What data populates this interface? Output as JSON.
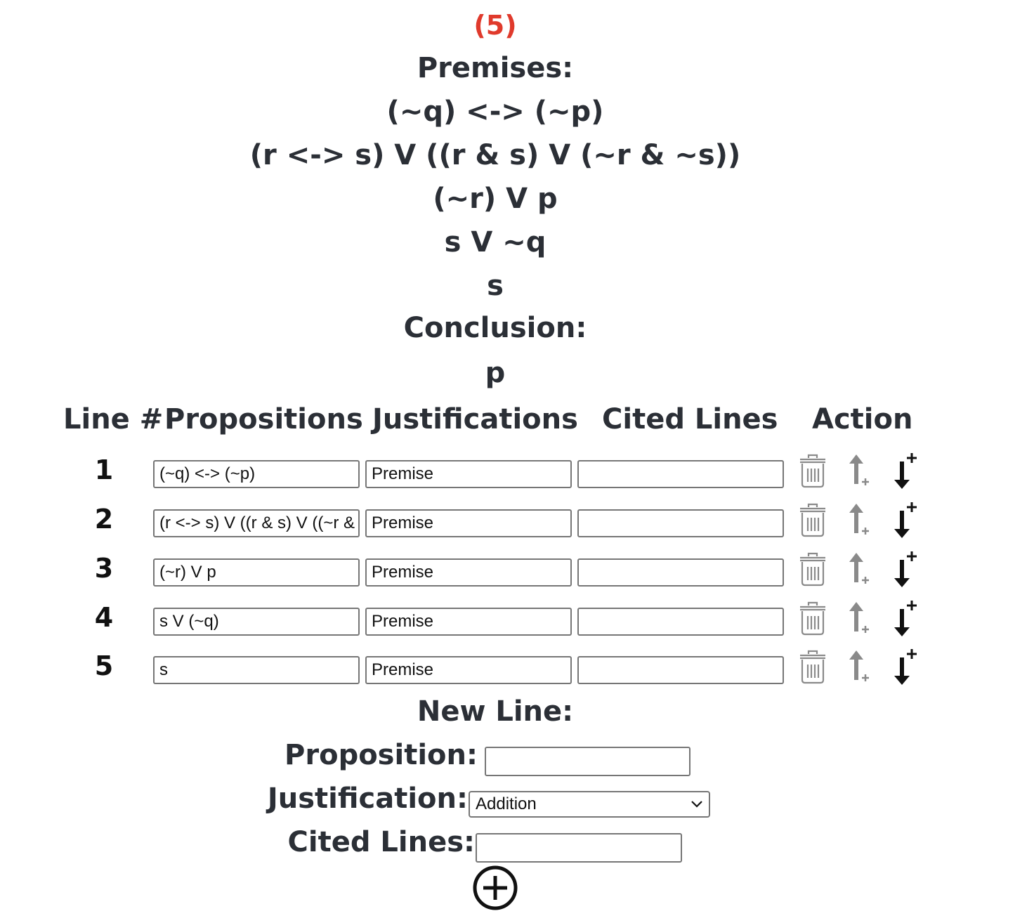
{
  "problem": {
    "number": "(5)",
    "premises_heading": "Premises:",
    "premises": [
      "(~q) <-> (~p)",
      "(r <-> s) V ((r & s) V (~r & ~s))",
      "(~r) V p",
      "s V ~q",
      "s"
    ],
    "conclusion_heading": "Conclusion:",
    "conclusion": "p"
  },
  "table": {
    "headers": {
      "line": "Line #",
      "propositions": "Propositions",
      "justifications": "Justifications",
      "cited": "Cited Lines",
      "action": "Action"
    },
    "rows": [
      {
        "num": "1",
        "proposition": "(~q) <-> (~p)",
        "justification": "Premise",
        "cited": ""
      },
      {
        "num": "2",
        "proposition": "(r <-> s) V ((r & s) V ((~r & ~s))",
        "justification": "Premise",
        "cited": ""
      },
      {
        "num": "3",
        "proposition": "(~r) V p",
        "justification": "Premise",
        "cited": ""
      },
      {
        "num": "4",
        "proposition": "s V (~q)",
        "justification": "Premise",
        "cited": ""
      },
      {
        "num": "5",
        "proposition": "s",
        "justification": "Premise",
        "cited": ""
      }
    ],
    "action_icons": [
      "trash-icon",
      "insert-above-icon",
      "insert-below-icon"
    ]
  },
  "new_line": {
    "heading": "New Line:",
    "proposition_label": "Proposition:",
    "proposition_value": "",
    "justification_label": "Justification:",
    "justification_selected": "Addition",
    "cited_label": "Cited Lines:",
    "cited_value": "",
    "add_icon": "plus-circle-icon"
  },
  "colors": {
    "problem_number": "#e03a2c",
    "text": "#2b2f36",
    "icon_gray": "#8a8a8a",
    "icon_black": "#111111"
  }
}
